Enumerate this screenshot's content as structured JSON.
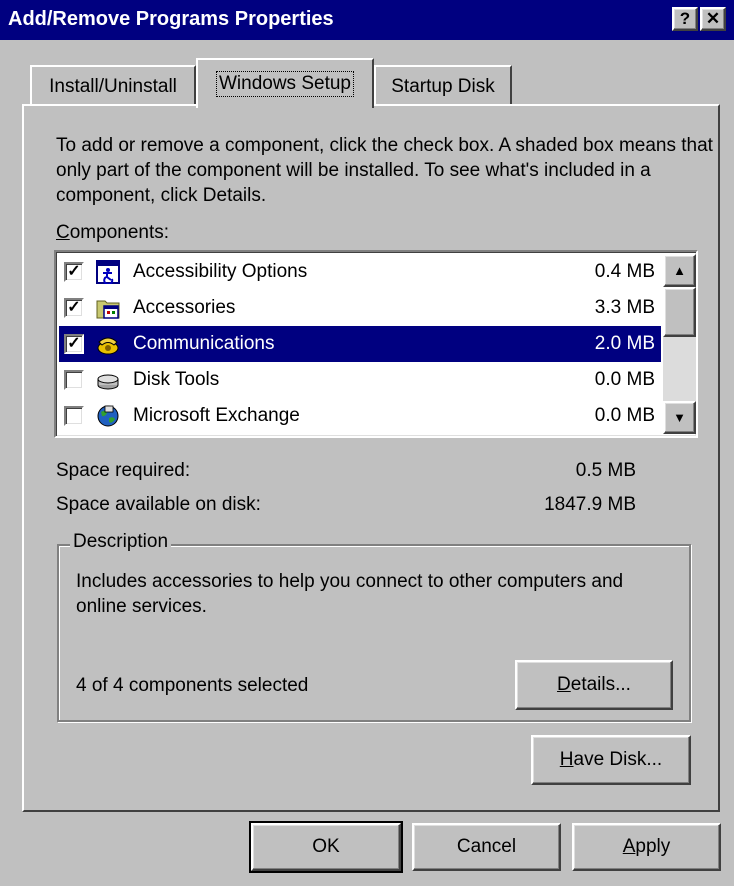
{
  "window": {
    "title": "Add/Remove Programs Properties",
    "help_button": "?",
    "close_button": "✕"
  },
  "tabs": [
    {
      "label": "Install/Uninstall",
      "active": false
    },
    {
      "label": "Windows Setup",
      "active": true
    },
    {
      "label": "Startup Disk",
      "active": false
    }
  ],
  "setup": {
    "intro": "To add or remove a component, click the check box. A shaded box means that only part of the component will be installed. To see what's included in a component, click Details.",
    "components_label_mnemonic": "C",
    "components_label_rest": "omponents:",
    "components": [
      {
        "name": "Accessibility Options",
        "size": "0.4 MB",
        "checked": true,
        "selected": false,
        "icon": "accessibility-icon"
      },
      {
        "name": "Accessories",
        "size": "3.3 MB",
        "checked": true,
        "selected": false,
        "icon": "accessories-icon"
      },
      {
        "name": "Communications",
        "size": "2.0 MB",
        "checked": true,
        "selected": true,
        "icon": "communications-icon"
      },
      {
        "name": "Disk Tools",
        "size": "0.0 MB",
        "checked": false,
        "selected": false,
        "icon": "disk-tools-icon"
      },
      {
        "name": "Microsoft Exchange",
        "size": "0.0 MB",
        "checked": false,
        "selected": false,
        "icon": "exchange-icon"
      }
    ],
    "space_required_label": "Space required:",
    "space_required_value": "0.5 MB",
    "space_available_label": "Space available on disk:",
    "space_available_value": "1847.9 MB",
    "description_legend": "Description",
    "description_text": "Includes accessories to help you connect to other computers and online services.",
    "selection_count": "4 of 4 components selected",
    "details_mnemonic": "D",
    "details_rest": "etails...",
    "have_disk_mnemonic": "H",
    "have_disk_rest": "ave Disk..."
  },
  "buttons": {
    "ok": "OK",
    "cancel": "Cancel",
    "apply_mnemonic": "A",
    "apply_rest": "pply"
  },
  "colors": {
    "titlebar": "#000080",
    "face": "#c0c0c0",
    "selection": "#000080"
  }
}
